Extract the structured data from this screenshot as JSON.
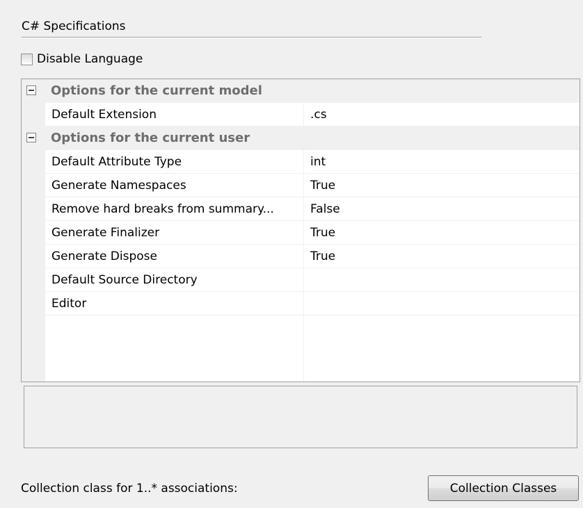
{
  "section": {
    "title": "C# Specifications"
  },
  "disable_language": {
    "label": "Disable Language",
    "checked": false
  },
  "property_grid": {
    "categories": [
      {
        "label": "Options for the current model",
        "expanded": true,
        "properties": [
          {
            "name": "Default Extension",
            "value": ".cs"
          }
        ]
      },
      {
        "label": "Options for the current user",
        "expanded": true,
        "properties": [
          {
            "name": "Default Attribute Type",
            "value": "int"
          },
          {
            "name": "Generate Namespaces",
            "value": "True"
          },
          {
            "name": "Remove hard breaks from summary...",
            "value": "False"
          },
          {
            "name": "Generate Finalizer",
            "value": "True"
          },
          {
            "name": "Generate Dispose",
            "value": "True"
          },
          {
            "name": "Default Source Directory",
            "value": ""
          },
          {
            "name": "Editor",
            "value": ""
          }
        ]
      }
    ]
  },
  "description": {
    "text": ""
  },
  "footer": {
    "label": "Collection class for 1..* associations:",
    "button_label": "Collection Classes"
  },
  "colors": {
    "panel_background": "#f0f0f0",
    "grid_background": "#ffffff",
    "category_text": "#6d6d6d",
    "border": "#a0a0a0"
  },
  "icons": {
    "collapse_toggle": "minus-box-icon",
    "checkbox": "checkbox-unchecked-icon"
  }
}
